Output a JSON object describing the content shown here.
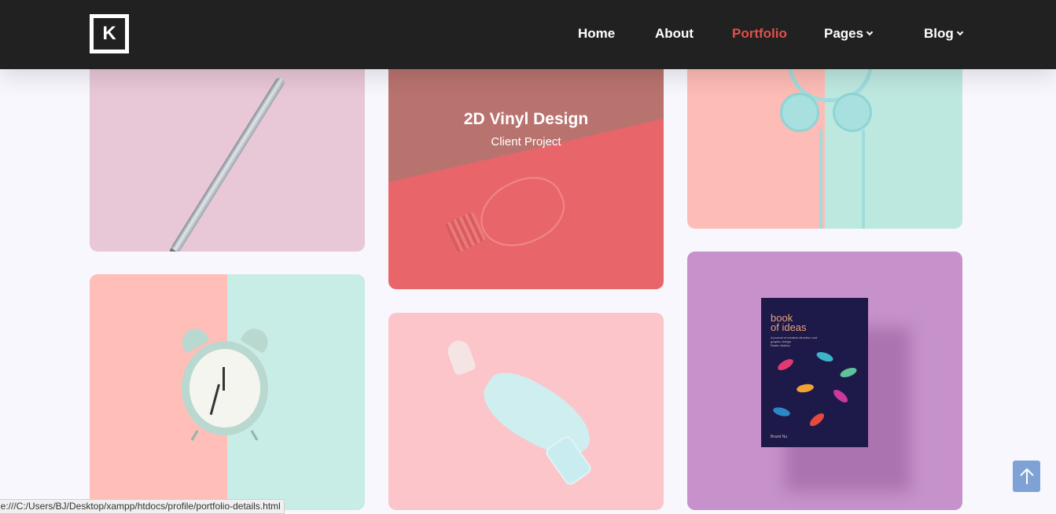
{
  "header": {
    "logo_letter": "K",
    "nav": [
      "Home",
      "About",
      "Portfolio",
      "Pages",
      "Blog"
    ],
    "active": "Portfolio"
  },
  "portfolio": {
    "featured_title": "2D Vinyl Design",
    "featured_subtitle": "Client Project",
    "book": {
      "title_line1": "book",
      "title_line2": "of ideas",
      "blurb": "A journal of creative direction and graphic design",
      "author": "Radim Malinic",
      "publisher": "Brand Nu"
    }
  },
  "scroll_top_icon": "arrow-up-icon",
  "status_url": "file:///C:/Users/BJ/Desktop/xampp/htdocs/profile/portfolio-details.html",
  "colors": {
    "header_bg": "#212121",
    "accent": "#e2504c",
    "page_bg": "#f8f7fd",
    "scroll_button": "#7ea2d6"
  }
}
